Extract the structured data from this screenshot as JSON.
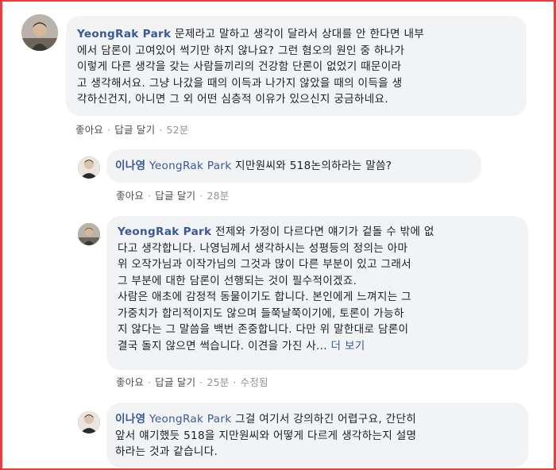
{
  "comments": [
    {
      "author": "YeongRak Park",
      "lines": [
        "문제라고 말하고 생각이 달라서 상대를 안 한다면 내부",
        "에서 담론이 고여있어 썩기만 하지 않나요? 그런 혐오의 원인 중 하나가",
        "이렇게 다른 생각을 갖는 사람들끼리의 건강함 단론이 없었기 때문이라",
        "고 생각해서요. 그냥 나갔을 때의 이득과 나가지 않았을 때의 이득을 생",
        "각하신건지, 아니면 그 외 어떤 심층적 이유가 있으신지 궁금하네요."
      ],
      "actions": {
        "like": "좋아요",
        "reply": "답글 달기",
        "time": "52분"
      }
    },
    {
      "author": "이나영",
      "tag": "YeongRak Park",
      "lines": [
        "지만원씨와 518논의하라는 말씀?"
      ],
      "actions": {
        "like": "좋아요",
        "reply": "답글 달기",
        "time": "28분"
      }
    },
    {
      "author": "YeongRak Park",
      "lines": [
        "전제와 가정이 다르다면 얘기가 겉돌 수 밖에 없",
        "다고 생각합니다. 나영님께서 생각하시는 성평등의 정의는 아마",
        "위 오작가님과 이작가님의 그것과 많이 다른 부분이 있고 그래서",
        "그 부분에 대한 담론이 선행되는 것이 필수적이겠죠.",
        "사람은 애초에 감정적 동물이기도 합니다. 본인에게 느껴지는 그",
        "가중치가 합리적이지도 않으며 들쭉날쭉이기에, 토론이 가능하",
        "지 않다는 그 말씀을 백번 존중합니다. 다만 위 말한대로 담론이",
        "결국 돌지 않으면 썩습니다. 이견을 가진 사..."
      ],
      "more": "더 보기",
      "actions": {
        "like": "좋아요",
        "reply": "답글 달기",
        "time": "25분",
        "edited": "수정됨"
      }
    },
    {
      "author": "이나영",
      "tag": "YeongRak Park",
      "lines": [
        "그걸 여기서 강의하긴 어렵구요, 간단히",
        "앞서 얘기했듯 518을 지만원씨와 어떻게 다르게 생각하는지 설명",
        "하라는 것과 같습니다."
      ]
    }
  ],
  "colors": {
    "frame_border": "#ee3b3b",
    "bubble_bg": "#f2f3f5",
    "link_blue": "#385898",
    "text": "#1c1e21",
    "meta_gray": "#90949c"
  },
  "icons": {
    "avatar": "user-avatar-photo"
  }
}
